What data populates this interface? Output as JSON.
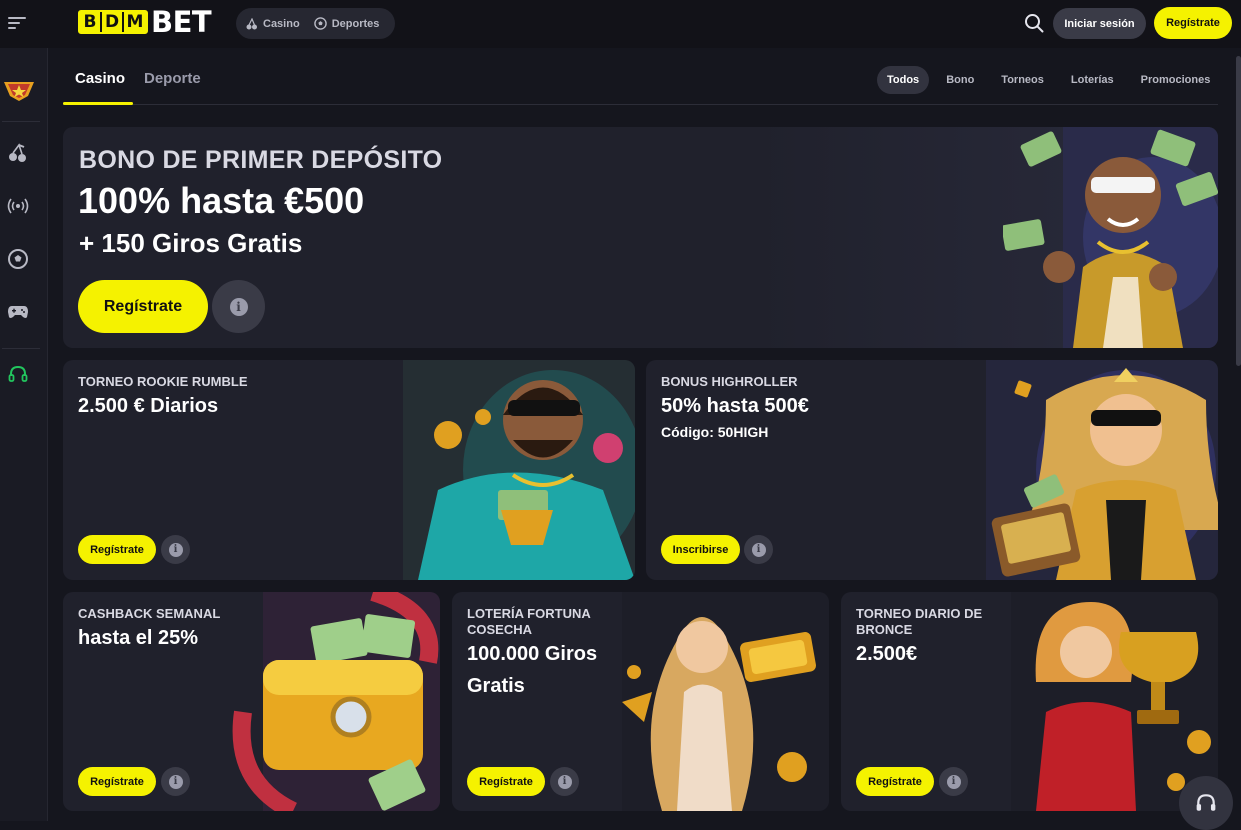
{
  "header": {
    "logo_letters": [
      "B",
      "D",
      "M"
    ],
    "logo_suffix": "BET",
    "nav_pill": [
      {
        "label": "Casino",
        "icon": "cherry-icon"
      },
      {
        "label": "Deportes",
        "icon": "soccer-ball-icon"
      }
    ],
    "login_label": "Iniciar sesión",
    "register_label": "Regístrate"
  },
  "sidebar": {
    "icons": [
      "vip-badge-icon",
      "cherry-icon",
      "live-broadcast-icon",
      "soccer-ball-icon",
      "gamepad-icon",
      "headset-icon"
    ]
  },
  "tabs": [
    {
      "label": "Casino",
      "active": true
    },
    {
      "label": "Deporte",
      "active": false
    }
  ],
  "filters": [
    {
      "label": "Todos",
      "active": true
    },
    {
      "label": "Bono",
      "active": false
    },
    {
      "label": "Torneos",
      "active": false
    },
    {
      "label": "Loterías",
      "active": false
    },
    {
      "label": "Promociones",
      "active": false
    }
  ],
  "hero": {
    "title": "BONO DE PRIMER DEPÓSITO",
    "headline": "100% hasta €500",
    "subline": "+ 150 Giros Gratis",
    "button": "Regístrate"
  },
  "cards": [
    {
      "title": "TORNEO ROOKIE RUMBLE",
      "big": "2.500 € Diarios",
      "button": "Regístrate"
    },
    {
      "title": "BONUS HIGHROLLER",
      "big": "50% hasta 500€",
      "sub": "Código: 50HIGH",
      "button": "Inscribirse"
    },
    {
      "title": "CASHBACK SEMANAL",
      "big": "hasta el 25%",
      "button": "Regístrate"
    },
    {
      "title_line1": "LOTERÍA FORTUNA",
      "title_line2": "COSECHA",
      "big_line1": "100.000 Giros",
      "big_line2": "Gratis",
      "button": "Regístrate"
    },
    {
      "title_line1": "TORNEO DIARIO DE",
      "title_line2": "BRONCE",
      "big": "2.500€",
      "button": "Regístrate"
    }
  ],
  "colors": {
    "accent": "#f5f200",
    "bg": "#15161e",
    "card": "#20212c",
    "pill": "#3a3b47"
  }
}
